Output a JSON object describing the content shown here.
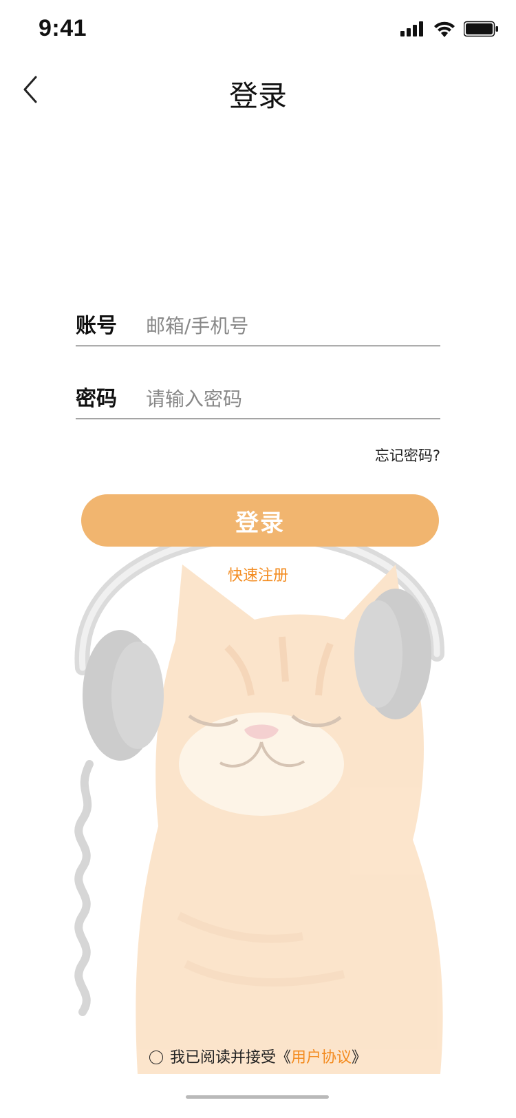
{
  "status_bar": {
    "time": "9:41",
    "icons": [
      "signal-icon",
      "wifi-icon",
      "battery-icon"
    ]
  },
  "nav": {
    "back_icon": "chevron-left-icon",
    "title": "登录"
  },
  "form": {
    "account": {
      "label": "账号",
      "placeholder": "邮箱/手机号",
      "value": ""
    },
    "password": {
      "label": "密码",
      "placeholder": "请输入密码",
      "value": ""
    },
    "forgot_password": "忘记密码?"
  },
  "actions": {
    "login_label": "登录",
    "register_label": "快速注册"
  },
  "agreement": {
    "prefix": "我已阅读并接受《",
    "link": "用户协议",
    "suffix": "》",
    "checked": false
  },
  "colors": {
    "accent": "#f1b56f",
    "link": "#f38b1f",
    "text": "#111111"
  },
  "background_art": "cat-with-headphones-illustration"
}
